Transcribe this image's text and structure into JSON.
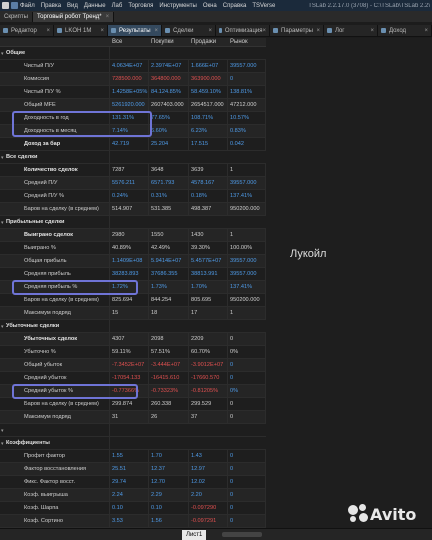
{
  "menubar": {
    "items": [
      "Скрипты",
      "Торговый робот Тренд*",
      "Файл",
      "Правка",
      "Вид",
      "Данные",
      "Лаб",
      "Торговля",
      "Инструменты",
      "Окна",
      "Справка",
      "TSVerse"
    ],
    "version": "TSLab 2.2.17.0 (3708) - C:\\TSLab\\TSLab 2.2\\"
  },
  "doc_tabs": [
    {
      "label": "Скрипты"
    },
    {
      "label": "Торговый робот Тренд*",
      "close": "×"
    }
  ],
  "view_tabs": [
    {
      "label": "Редактор",
      "close": "×"
    },
    {
      "label": "LKOH 1M",
      "close": "×"
    },
    {
      "label": "Результаты",
      "close": "×"
    },
    {
      "label": "Сделки",
      "close": "×"
    },
    {
      "label": "Оптимизация",
      "close": "×"
    },
    {
      "label": "Параметры",
      "close": "×"
    },
    {
      "label": "Лог",
      "close": "×"
    },
    {
      "label": "Доход",
      "close": "×"
    }
  ],
  "columns": [
    "Все",
    "Покупки",
    "Продажи",
    "Рынок"
  ],
  "rows": [
    {
      "type": "section",
      "label": "Общие"
    },
    {
      "label": "Чистый П/У",
      "v": [
        "4.0634E+07",
        "2.3974E+07",
        "1.666E+07",
        "39557.000"
      ],
      "c": [
        "#4f9be8",
        "#4f9be8",
        "#4f9be8",
        "#4f9be8"
      ]
    },
    {
      "label": "Комиссия",
      "v": [
        "728500.000",
        "364800.000",
        "363900.000",
        "0"
      ],
      "c": [
        "#e05050",
        "#e05050",
        "#e05050",
        "#4f9be8"
      ]
    },
    {
      "label": "Чистый П/У %",
      "v": [
        "1.4258E+05%",
        "84.124.85%",
        "58.459.10%",
        "138.81%"
      ],
      "c": [
        "#4f9be8",
        "#4f9be8",
        "#4f9be8",
        "#4f9be8"
      ]
    },
    {
      "label": "Общий MFE",
      "v": [
        "5261920.000",
        "2607403.000",
        "2654517.000",
        "47212.000"
      ],
      "c": [
        "#4f9be8",
        "#cfcfcf",
        "#cfcfcf",
        "#cfcfcf"
      ]
    },
    {
      "label": "Доходность в год",
      "v": [
        "131.31%",
        "77.65%",
        "108.71%",
        "10.57%"
      ],
      "c": [
        "#4f9be8",
        "#4f9be8",
        "#4f9be8",
        "#4f9be8"
      ]
    },
    {
      "label": "Доходность в месяц",
      "v": [
        "7.14%",
        "6.60%",
        "6.23%",
        "0.83%"
      ],
      "c": [
        "#4f9be8",
        "#4f9be8",
        "#4f9be8",
        "#4f9be8"
      ]
    },
    {
      "type": "bold",
      "label": "Доход за бар",
      "v": [
        "42.719",
        "25.204",
        "17.515",
        "0.042"
      ],
      "c": [
        "#4f9be8",
        "#4f9be8",
        "#4f9be8",
        "#4f9be8"
      ]
    },
    {
      "type": "section",
      "label": "Все сделки"
    },
    {
      "type": "bold",
      "label": "Количество сделок",
      "v": [
        "7287",
        "3648",
        "3639",
        "1"
      ],
      "c": [
        "#cfcfcf",
        "#cfcfcf",
        "#cfcfcf",
        "#cfcfcf"
      ]
    },
    {
      "label": "Средний П/У",
      "v": [
        "5576.211",
        "6571.793",
        "4578.167",
        "39557.000"
      ],
      "c": [
        "#4f9be8",
        "#4f9be8",
        "#4f9be8",
        "#4f9be8"
      ]
    },
    {
      "label": "Средний П/У %",
      "v": [
        "0.24%",
        "0.31%",
        "0.18%",
        "137.41%"
      ],
      "c": [
        "#4f9be8",
        "#4f9be8",
        "#4f9be8",
        "#4f9be8"
      ]
    },
    {
      "label": "Баров на сделку (в среднем)",
      "v": [
        "514.907",
        "531.385",
        "498.387",
        "950200.000"
      ],
      "c": [
        "#cfcfcf",
        "#cfcfcf",
        "#cfcfcf",
        "#cfcfcf"
      ]
    },
    {
      "type": "section",
      "label": "Прибыльные сделки"
    },
    {
      "type": "bold",
      "label": "Выиграно сделок",
      "v": [
        "2980",
        "1550",
        "1430",
        "1"
      ],
      "c": [
        "#cfcfcf",
        "#cfcfcf",
        "#cfcfcf",
        "#cfcfcf"
      ]
    },
    {
      "label": "Выиграно %",
      "v": [
        "40.89%",
        "42.49%",
        "39.30%",
        "100.00%"
      ],
      "c": [
        "#cfcfcf",
        "#cfcfcf",
        "#cfcfcf",
        "#cfcfcf"
      ]
    },
    {
      "label": "Общая прибыль",
      "v": [
        "1.1409E+08",
        "5.9414E+07",
        "5.4577E+07",
        "39557.000"
      ],
      "c": [
        "#4f9be8",
        "#4f9be8",
        "#4f9be8",
        "#4f9be8"
      ]
    },
    {
      "label": "Средняя прибыль",
      "v": [
        "38283.893",
        "37686.355",
        "38813.991",
        "39557.000"
      ],
      "c": [
        "#4f9be8",
        "#4f9be8",
        "#4f9be8",
        "#4f9be8"
      ]
    },
    {
      "label": "Средняя прибыль %",
      "v": [
        "1.72%",
        "1.73%",
        "1.70%",
        "137.41%"
      ],
      "c": [
        "#4f9be8",
        "#4f9be8",
        "#4f9be8",
        "#4f9be8"
      ]
    },
    {
      "label": "Баров на сделку (в среднем)",
      "v": [
        "825.694",
        "844.254",
        "805.695",
        "950200.000"
      ],
      "c": [
        "#cfcfcf",
        "#cfcfcf",
        "#cfcfcf",
        "#cfcfcf"
      ]
    },
    {
      "label": "Максимум подряд",
      "v": [
        "15",
        "18",
        "17",
        "1"
      ],
      "c": [
        "#cfcfcf",
        "#cfcfcf",
        "#cfcfcf",
        "#cfcfcf"
      ]
    },
    {
      "type": "section",
      "label": "Убыточные сделки"
    },
    {
      "type": "bold",
      "label": "Убыточных сделок",
      "v": [
        "4307",
        "2098",
        "2209",
        "0"
      ],
      "c": [
        "#cfcfcf",
        "#cfcfcf",
        "#cfcfcf",
        "#cfcfcf"
      ]
    },
    {
      "label": "Убыточно %",
      "v": [
        "59.11%",
        "57.51%",
        "60.70%",
        "0%"
      ],
      "c": [
        "#cfcfcf",
        "#cfcfcf",
        "#cfcfcf",
        "#cfcfcf"
      ]
    },
    {
      "label": "Общий убыток",
      "v": [
        "-7.3452E+07",
        "-3.444E+07",
        "-3.9012E+07",
        "0"
      ],
      "c": [
        "#e05050",
        "#e05050",
        "#e05050",
        "#4f9be8"
      ]
    },
    {
      "label": "Средний убыток",
      "v": [
        "-17054.133",
        "-16415.610",
        "-17660.570",
        "0"
      ],
      "c": [
        "#e05050",
        "#e05050",
        "#e05050",
        "#4f9be8"
      ]
    },
    {
      "label": "Средний убыток %",
      "v": [
        "-0.77366%",
        "-0.73323%",
        "-0.81205%",
        "0%"
      ],
      "c": [
        "#e05050",
        "#e05050",
        "#e05050",
        "#4f9be8"
      ]
    },
    {
      "label": "Баров на сделку (в среднем)",
      "v": [
        "299.874",
        "260.338",
        "299.529",
        "0"
      ],
      "c": [
        "#cfcfcf",
        "#cfcfcf",
        "#cfcfcf",
        "#cfcfcf"
      ]
    },
    {
      "label": "Максимум подряд",
      "v": [
        "31",
        "26",
        "37",
        "0"
      ],
      "c": [
        "#cfcfcf",
        "#cfcfcf",
        "#cfcfcf",
        "#cfcfcf"
      ]
    },
    {
      "type": "section",
      "label": ""
    },
    {
      "type": "section",
      "label": "Коэффициенты"
    },
    {
      "label": "Профит фактор",
      "v": [
        "1.55",
        "1.70",
        "1.43",
        "0"
      ],
      "c": [
        "#4f9be8",
        "#4f9be8",
        "#4f9be8",
        "#4f9be8"
      ]
    },
    {
      "label": "Фактор восстановления",
      "v": [
        "25.51",
        "12.37",
        "12.97",
        "0"
      ],
      "c": [
        "#4f9be8",
        "#4f9be8",
        "#4f9be8",
        "#4f9be8"
      ]
    },
    {
      "label": "Фикс. Фактор восст.",
      "v": [
        "29.74",
        "12.70",
        "12.02",
        "0"
      ],
      "c": [
        "#4f9be8",
        "#4f9be8",
        "#4f9be8",
        "#4f9be8"
      ]
    },
    {
      "label": "Коэф. выигрыша",
      "v": [
        "2.24",
        "2.29",
        "2.20",
        "0"
      ],
      "c": [
        "#4f9be8",
        "#4f9be8",
        "#4f9be8",
        "#4f9be8"
      ]
    },
    {
      "label": "Коэф. Шарпа",
      "v": [
        "0.10",
        "0.10",
        "-0.097290",
        "0"
      ],
      "c": [
        "#4f9be8",
        "#4f9be8",
        "#e05050",
        "#4f9be8"
      ]
    },
    {
      "label": "Коэф. Сортино",
      "v": [
        "3.53",
        "1.56",
        "-0.097291",
        "0"
      ],
      "c": [
        "#4f9be8",
        "#4f9be8",
        "#e05050",
        "#4f9be8"
      ]
    }
  ],
  "annotation": "Лукойл",
  "sheet_tab": "Лист1",
  "watermark": "Avito"
}
